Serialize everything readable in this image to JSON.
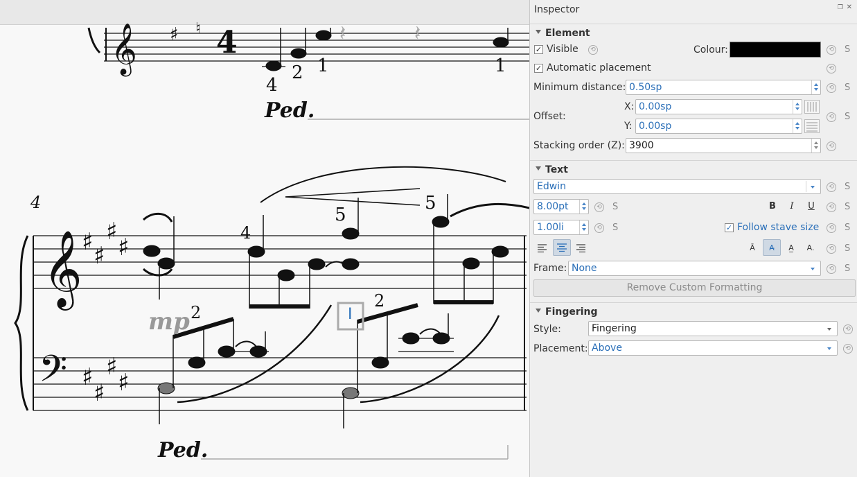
{
  "score": {
    "fingering_numbers": {
      "top": [
        "4",
        "2",
        "1",
        "1"
      ],
      "measure_four": [
        "4",
        "5",
        "5",
        "2",
        "2"
      ]
    },
    "measure_number": "4",
    "dynamic": "mp",
    "pedal_mark": "Ped.",
    "selected_text": "I"
  },
  "inspector": {
    "title": "Inspector",
    "float_icon": "float-icon",
    "close_icon": "close-icon",
    "element": {
      "header": "Element",
      "visible_label": "Visible",
      "visible_checked": true,
      "colour_label": "Colour:",
      "colour_value": "#000000",
      "auto_placement_label": "Automatic placement",
      "auto_placement_checked": true,
      "min_distance_label": "Minimum distance:",
      "min_distance_value": "0.50sp",
      "offset_label": "Offset:",
      "offset_x_label": "X:",
      "offset_x_value": "0.00sp",
      "offset_y_label": "Y:",
      "offset_y_value": "0.00sp",
      "stacking_label": "Stacking order (Z):",
      "stacking_value": "3900"
    },
    "text": {
      "header": "Text",
      "font_value": "Edwin",
      "size_value": "8.00pt",
      "spacing_value": "1.00li",
      "bold": "B",
      "italic": "I",
      "underline": "U",
      "follow_stave_label": "Follow stave size",
      "follow_stave_checked": true,
      "frame_label": "Frame:",
      "frame_value": "None",
      "remove_formatting": "Remove Custom Formatting"
    },
    "fingering": {
      "header": "Fingering",
      "style_label": "Style:",
      "style_value": "Fingering",
      "placement_label": "Placement:",
      "placement_value": "Above"
    },
    "s_label": "S"
  }
}
